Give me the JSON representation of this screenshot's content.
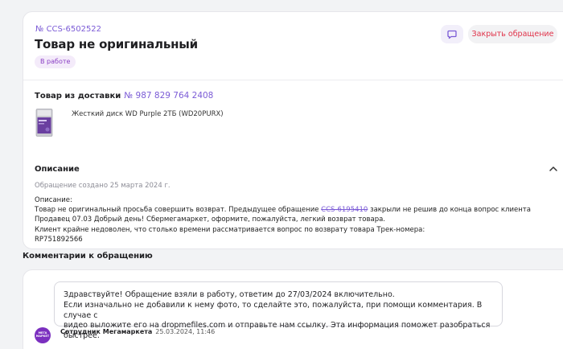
{
  "ticket": {
    "number": "№ CCS-6502522",
    "title": "Товар не оригинальный",
    "status": "В работе",
    "close_button": "Закрыть обращение"
  },
  "delivery": {
    "label": "Товар из доставки",
    "track_number": "№ 987 829 764 2408",
    "product_name": "Жесткий диск WD Purple 2ТБ (WD20PURX)"
  },
  "description": {
    "title": "Описание",
    "created_at": "Обращение создано 25 марта 2024 г.",
    "label": "Описание:",
    "line1_before": "Товар не оригинальный просьба совершить возврат. Предыдущее обращение",
    "line1_struck": "CCS-6195410",
    "line1_after": "закрыли не решив до конца вопрос клиента",
    "line2": "Продавец 07.03 Добрый день! Сбермегамаркет, оформите, пожалуйста, легкий возврат товара.",
    "line3": "Клиент крайне недоволен, что столько времени рассматривается вопрос по возврату товара Трек-номера:",
    "line4": "RP751892566"
  },
  "comments": {
    "header": "Комментарии к обращению",
    "items": [
      {
        "line1": "Здравствуйте! Обращение взяли в работу, ответим до 27/03/2024 включительно.",
        "line2": "Если изначально не добавили к нему фото, то сделайте это, пожалуйста, при помощи комментария. В случае с",
        "line3": "видео выложите его на dropmefiles.com и отправьте нам ссылку. Эта информация поможет разобраться быстрее.",
        "avatar_text": "МЕГА МАРКЕТ",
        "author": "Сотрудник Мегамаркета",
        "time": "25.03.2024, 11:46"
      }
    ]
  },
  "colors": {
    "accent": "#7b5bd6",
    "danger": "#e0334a",
    "badge_bg": "#f4ebfa",
    "avatar": "#7b2fbf"
  },
  "icons": [
    "chat-icon",
    "chevron-up-icon"
  ]
}
